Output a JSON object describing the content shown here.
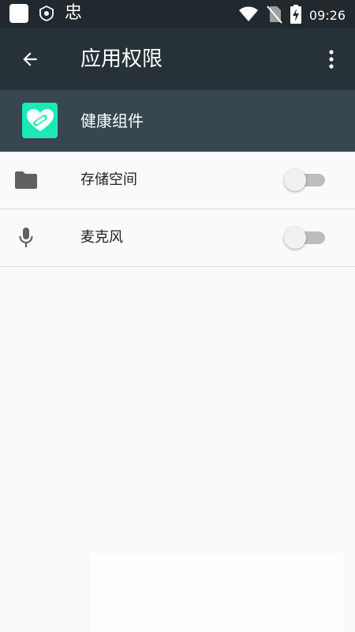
{
  "status_bar": {
    "notification_icons": [
      "white-square-icon",
      "badge-icon",
      "app-glyph-icon"
    ],
    "notification_glyph": "忠",
    "icons": [
      "wifi-icon",
      "no-sim-icon",
      "battery-charging-icon"
    ],
    "time": "09:26"
  },
  "app_bar": {
    "back_icon": "arrow-back-icon",
    "title": "应用权限",
    "more_icon": "more-vert-icon"
  },
  "app_header": {
    "icon": "health-widget-app-icon",
    "name": "健康组件",
    "icon_color": "#1de9b6"
  },
  "permissions": [
    {
      "icon": "folder-icon",
      "label": "存储空间",
      "enabled": false
    },
    {
      "icon": "microphone-icon",
      "label": "麦克风",
      "enabled": false
    }
  ],
  "colors": {
    "status_bar": "#22292e",
    "app_bar": "#263238",
    "app_header": "#37474f",
    "background": "#fafafa",
    "toggle_track_off": "#bdbdbd",
    "toggle_thumb_off": "#f1f1f1"
  }
}
